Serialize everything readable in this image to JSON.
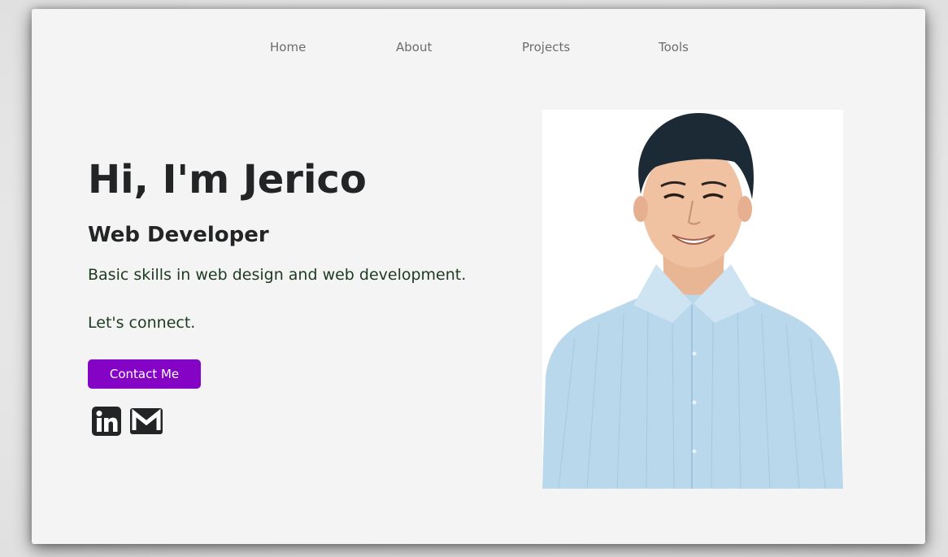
{
  "nav": {
    "items": [
      {
        "label": "Home"
      },
      {
        "label": "About"
      },
      {
        "label": "Projects"
      },
      {
        "label": "Tools"
      }
    ]
  },
  "hero": {
    "title": "Hi, I'm Jerico",
    "subtitle": "Web Developer",
    "description": "Basic skills in web design and web development.",
    "call_to_action": "Let's connect.",
    "contact_button_label": "Contact Me"
  },
  "socials": [
    {
      "icon": "linkedin-icon"
    },
    {
      "icon": "gmail-icon"
    }
  ],
  "colors": {
    "accent": "#8403c4",
    "text": "#222426",
    "nav_text": "#6c6c6c",
    "background": "#f4f4f4"
  },
  "photo": {
    "icon": "profile-photo"
  }
}
